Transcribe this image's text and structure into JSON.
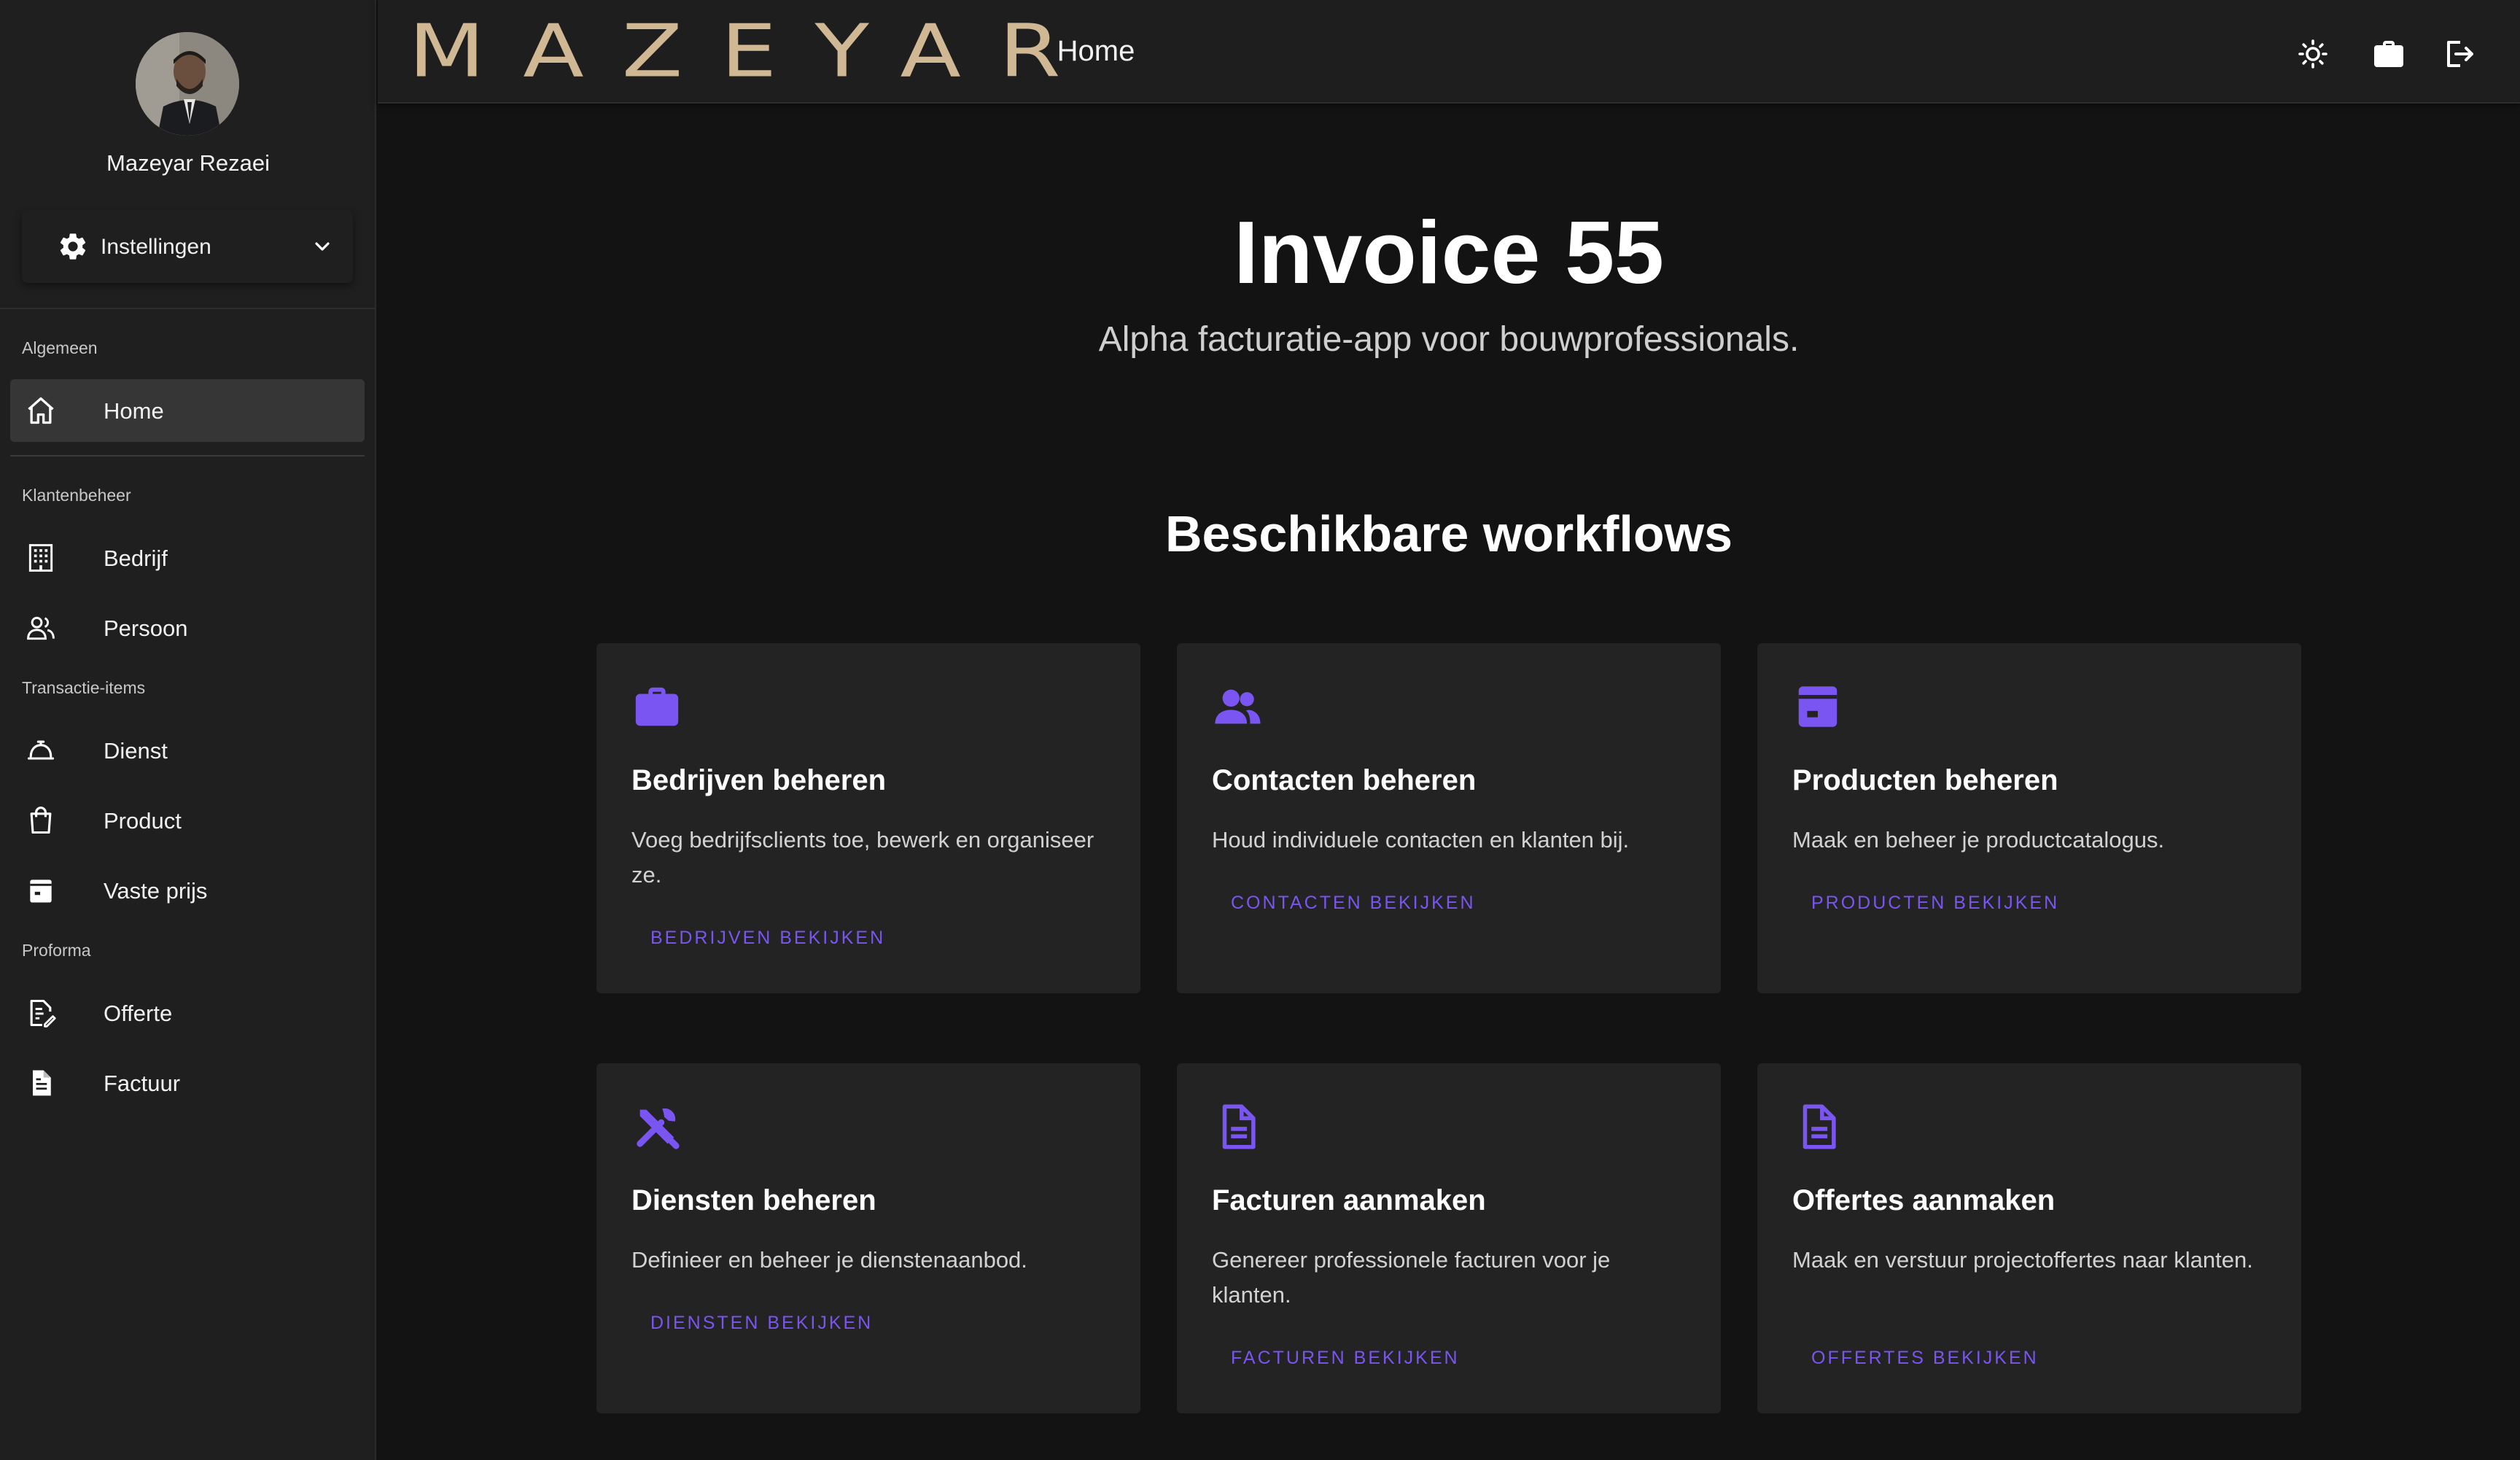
{
  "sidebar": {
    "profile_name": "Mazeyar Rezaei",
    "settings_label": "Instellingen",
    "sections": [
      {
        "label": "Algemeen"
      },
      {
        "label": "Klantenbeheer"
      },
      {
        "label": "Transactie-items"
      },
      {
        "label": "Proforma"
      }
    ],
    "items": [
      {
        "label": "Home",
        "icon": "home-icon",
        "active": true
      },
      {
        "label": "Bedrijf",
        "icon": "building-icon"
      },
      {
        "label": "Persoon",
        "icon": "people-icon"
      },
      {
        "label": "Dienst",
        "icon": "service-bell-icon"
      },
      {
        "label": "Product",
        "icon": "shopping-bag-icon"
      },
      {
        "label": "Vaste prijs",
        "icon": "price-tag-box-icon"
      },
      {
        "label": "Offerte",
        "icon": "edit-document-icon"
      },
      {
        "label": "Factuur",
        "icon": "document-icon"
      }
    ]
  },
  "header": {
    "logo_text": "MAZEYAR",
    "title": "Home",
    "icons": [
      "brightness-icon",
      "briefcase-icon",
      "logout-icon"
    ]
  },
  "main": {
    "title": "Invoice 55",
    "subtitle": "Alpha facturatie-app voor bouwprofessionals.",
    "section_title": "Beschikbare workflows",
    "cards": [
      {
        "title": "Bedrijven beheren",
        "description": "Voeg bedrijfsclients toe, bewerk en organiseer ze.",
        "link": "BEDRIJVEN BEKIJKEN",
        "icon": "briefcase-icon"
      },
      {
        "title": "Contacten beheren",
        "description": "Houd individuele contacten en klanten bij.",
        "link": "CONTACTEN BEKIJKEN",
        "icon": "people-icon"
      },
      {
        "title": "Producten beheren",
        "description": "Maak en beheer je productcatalogus.",
        "link": "PRODUCTEN BEKIJKEN",
        "icon": "archive-box-icon"
      },
      {
        "title": "Diensten beheren",
        "description": "Definieer en beheer je dienstenaanbod.",
        "link": "DIENSTEN BEKIJKEN",
        "icon": "tools-icon"
      },
      {
        "title": "Facturen aanmaken",
        "description": "Genereer professionele facturen voor je klanten.",
        "link": "FACTUREN BEKIJKEN",
        "icon": "document-icon"
      },
      {
        "title": "Offertes aanmaken",
        "description": "Maak en verstuur projectoffertes naar klanten.",
        "link": "OFFERTES BEKIJKEN",
        "icon": "document-icon"
      }
    ]
  },
  "colors": {
    "accent": "#7b55f2",
    "logo_gold": "#d1b894",
    "background": "#131313",
    "sidebar": "#1f1f1f",
    "card": "#232323"
  }
}
